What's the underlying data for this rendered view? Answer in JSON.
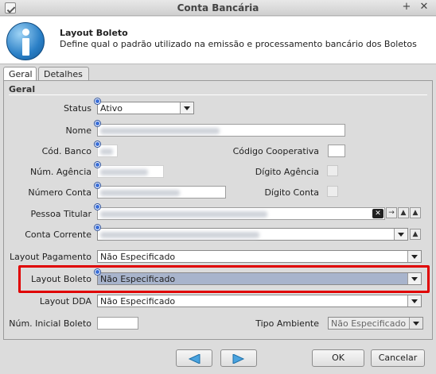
{
  "window": {
    "title": "Conta Bancária"
  },
  "header": {
    "title": "Layout Boleto",
    "description": "Define qual o padrão utilizado na emissão e processamento bancário dos Boletos"
  },
  "tabs": [
    {
      "label": "Geral"
    },
    {
      "label": "Detalhes"
    }
  ],
  "group": {
    "label": "Geral"
  },
  "fields": {
    "status": {
      "label": "Status",
      "value": "Ativo"
    },
    "nome": {
      "label": "Nome"
    },
    "cod_banco": {
      "label": "Cód. Banco"
    },
    "codigo_cooperativa": {
      "label": "Código Cooperativa"
    },
    "num_agencia": {
      "label": "Núm. Agência"
    },
    "digito_agencia": {
      "label": "Dígito Agência"
    },
    "numero_conta": {
      "label": "Número Conta"
    },
    "digito_conta": {
      "label": "Dígito Conta"
    },
    "pessoa_titular": {
      "label": "Pessoa Titular"
    },
    "conta_corrente": {
      "label": "Conta Corrente"
    },
    "layout_pagamento": {
      "label": "Layout Pagamento",
      "value": "Não Especificado"
    },
    "layout_boleto": {
      "label": "Layout Boleto",
      "value": "Não Especificado"
    },
    "layout_dda": {
      "label": "Layout DDA",
      "value": "Não Especificado"
    },
    "num_inicial_boleto": {
      "label": "Núm. Inicial Boleto",
      "value": ""
    },
    "tipo_ambiente": {
      "label": "Tipo Ambiente",
      "value": "Não Especificado"
    }
  },
  "buttons": {
    "ok": "OK",
    "cancel": "Cancelar"
  },
  "colors": {
    "accent": "#2a7fc6",
    "highlight": "#e00000",
    "selected_combo": "#a8b4cc"
  }
}
